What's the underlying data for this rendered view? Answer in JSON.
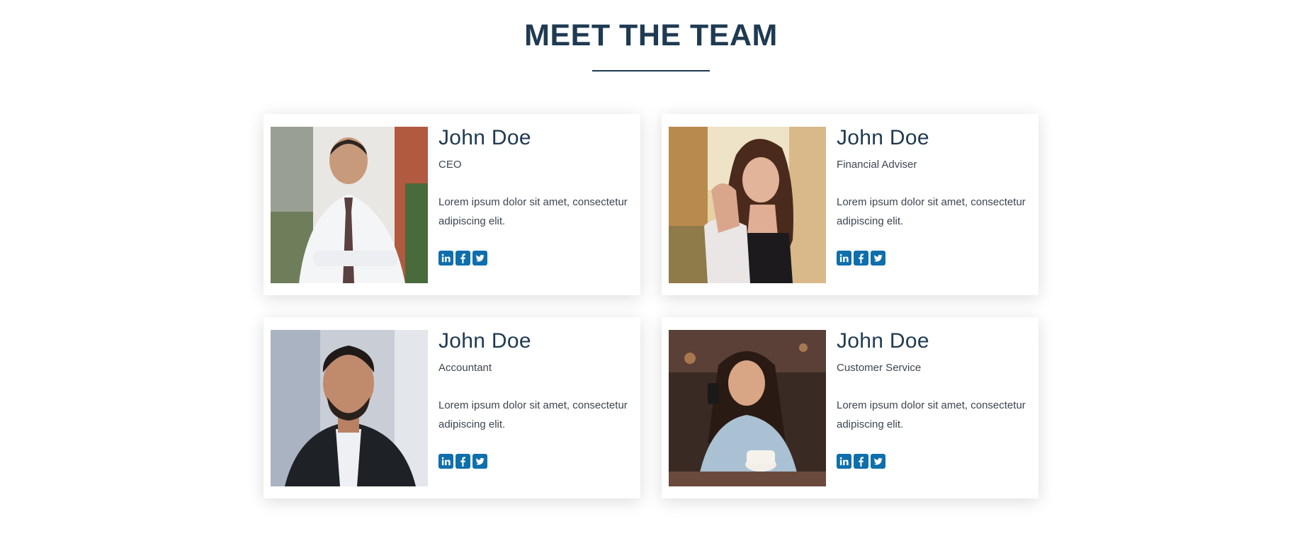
{
  "section": {
    "title": "MEET THE TEAM"
  },
  "members": [
    {
      "name": "John Doe",
      "role": "CEO",
      "description": "Lorem ipsum dolor sit amet, consectetur adipiscing elit.",
      "photo": "man-in-white-shirt-with-tie-photo"
    },
    {
      "name": "John Doe",
      "role": "Financial Adviser",
      "description": "Lorem ipsum dolor sit amet, consectetur adipiscing elit.",
      "photo": "woman-with-long-brown-hair-photo"
    },
    {
      "name": "John Doe",
      "role": "Accountant",
      "description": "Lorem ipsum dolor sit amet, consectetur adipiscing elit.",
      "photo": "bearded-man-in-dark-suit-photo"
    },
    {
      "name": "John Doe",
      "role": "Customer Service",
      "description": "Lorem ipsum dolor sit amet, consectetur adipiscing elit.",
      "photo": "woman-on-phone-with-coffee-photo"
    }
  ],
  "social_icons": [
    "linkedin-icon",
    "facebook-icon",
    "twitter-icon"
  ],
  "colors": {
    "heading": "#1f3a52",
    "social_icon": "#0f6fab",
    "text": "#3c4650",
    "background": "#ffffff"
  }
}
